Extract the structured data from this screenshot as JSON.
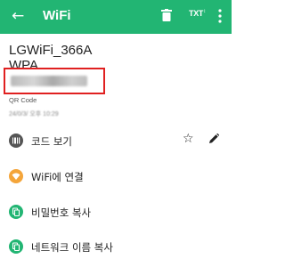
{
  "appbar": {
    "back_glyph": "←",
    "title": "WiFi",
    "trash_icon": "trash-icon",
    "txt_label": "TXT",
    "more_icon": "more-vert-icon",
    "color": "#22b573"
  },
  "details": {
    "ssid": "LGWiFi_366A",
    "security": "WPA",
    "password": "",
    "qr_label": "QR Code",
    "date": "24/0/3/ 오후 10:29"
  },
  "actions": [
    {
      "label": "코드 보기",
      "icon": "barcode-icon"
    },
    {
      "label": "WiFi에 연결",
      "icon": "wifi-icon"
    },
    {
      "label": "비밀번호 복사",
      "icon": "copy-icon"
    },
    {
      "label": "네트워크 이름 복사",
      "icon": "copy-icon"
    }
  ],
  "colors": {
    "accent": "#22b573",
    "highlight": "#e02020",
    "wifi_orange": "#f4a53a"
  }
}
